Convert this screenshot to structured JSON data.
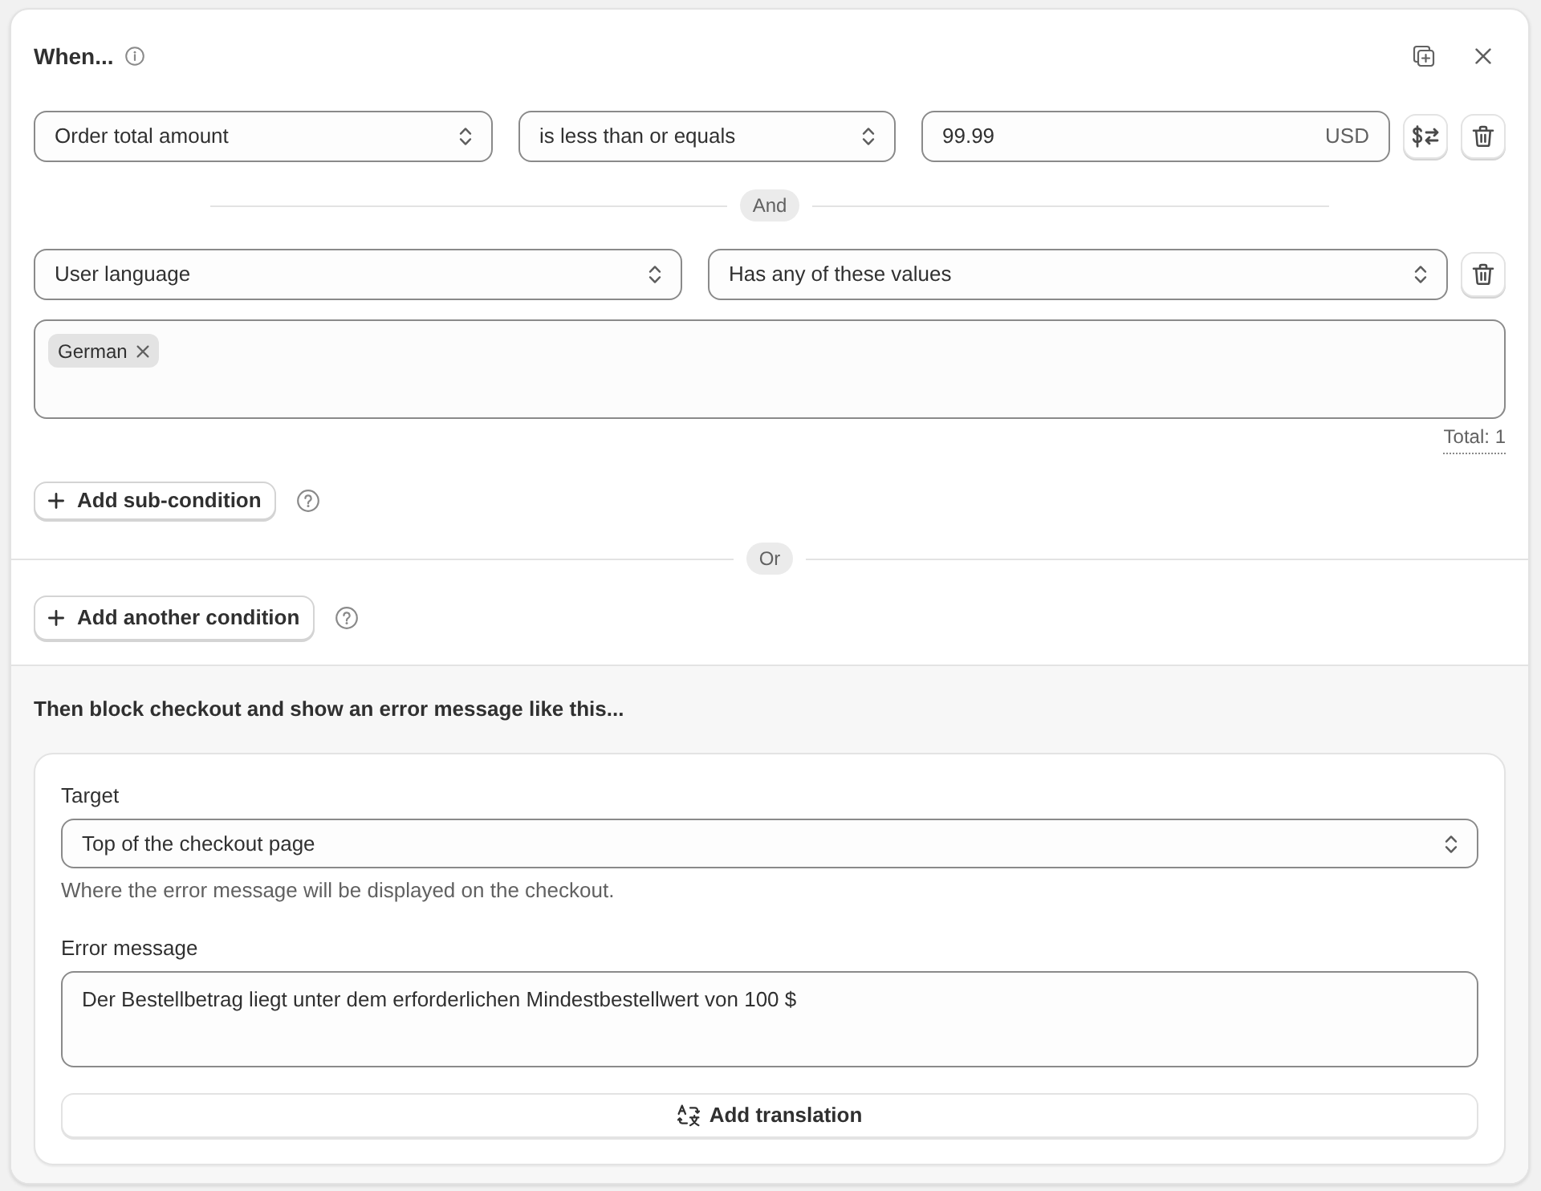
{
  "header": {
    "title": "When..."
  },
  "conditions": [
    {
      "connector": "And",
      "rules": [
        {
          "kind": "compare",
          "field": "Order total amount",
          "operator": "is less than or equals",
          "value": "99.99",
          "unit": "USD"
        },
        {
          "kind": "multi_value",
          "field": "User language",
          "operator": "Has any of these values",
          "tags": [
            {
              "label": "German"
            }
          ],
          "total": "Total: 1"
        }
      ],
      "add_sub_condition": "Add sub-condition"
    }
  ],
  "condition_separator": "Or",
  "add_condition": "Add another condition",
  "action": {
    "title": "Then block checkout and show an error message like this...",
    "target": {
      "label": "Target",
      "value": "Top of the checkout page",
      "help": "Where the error message will be displayed on the checkout."
    },
    "message": {
      "label": "Error message",
      "value": "Der Bestellbetrag liegt unter dem erforderlichen Mindestbestellwert von 100 $"
    },
    "add_translation": "Add translation"
  }
}
